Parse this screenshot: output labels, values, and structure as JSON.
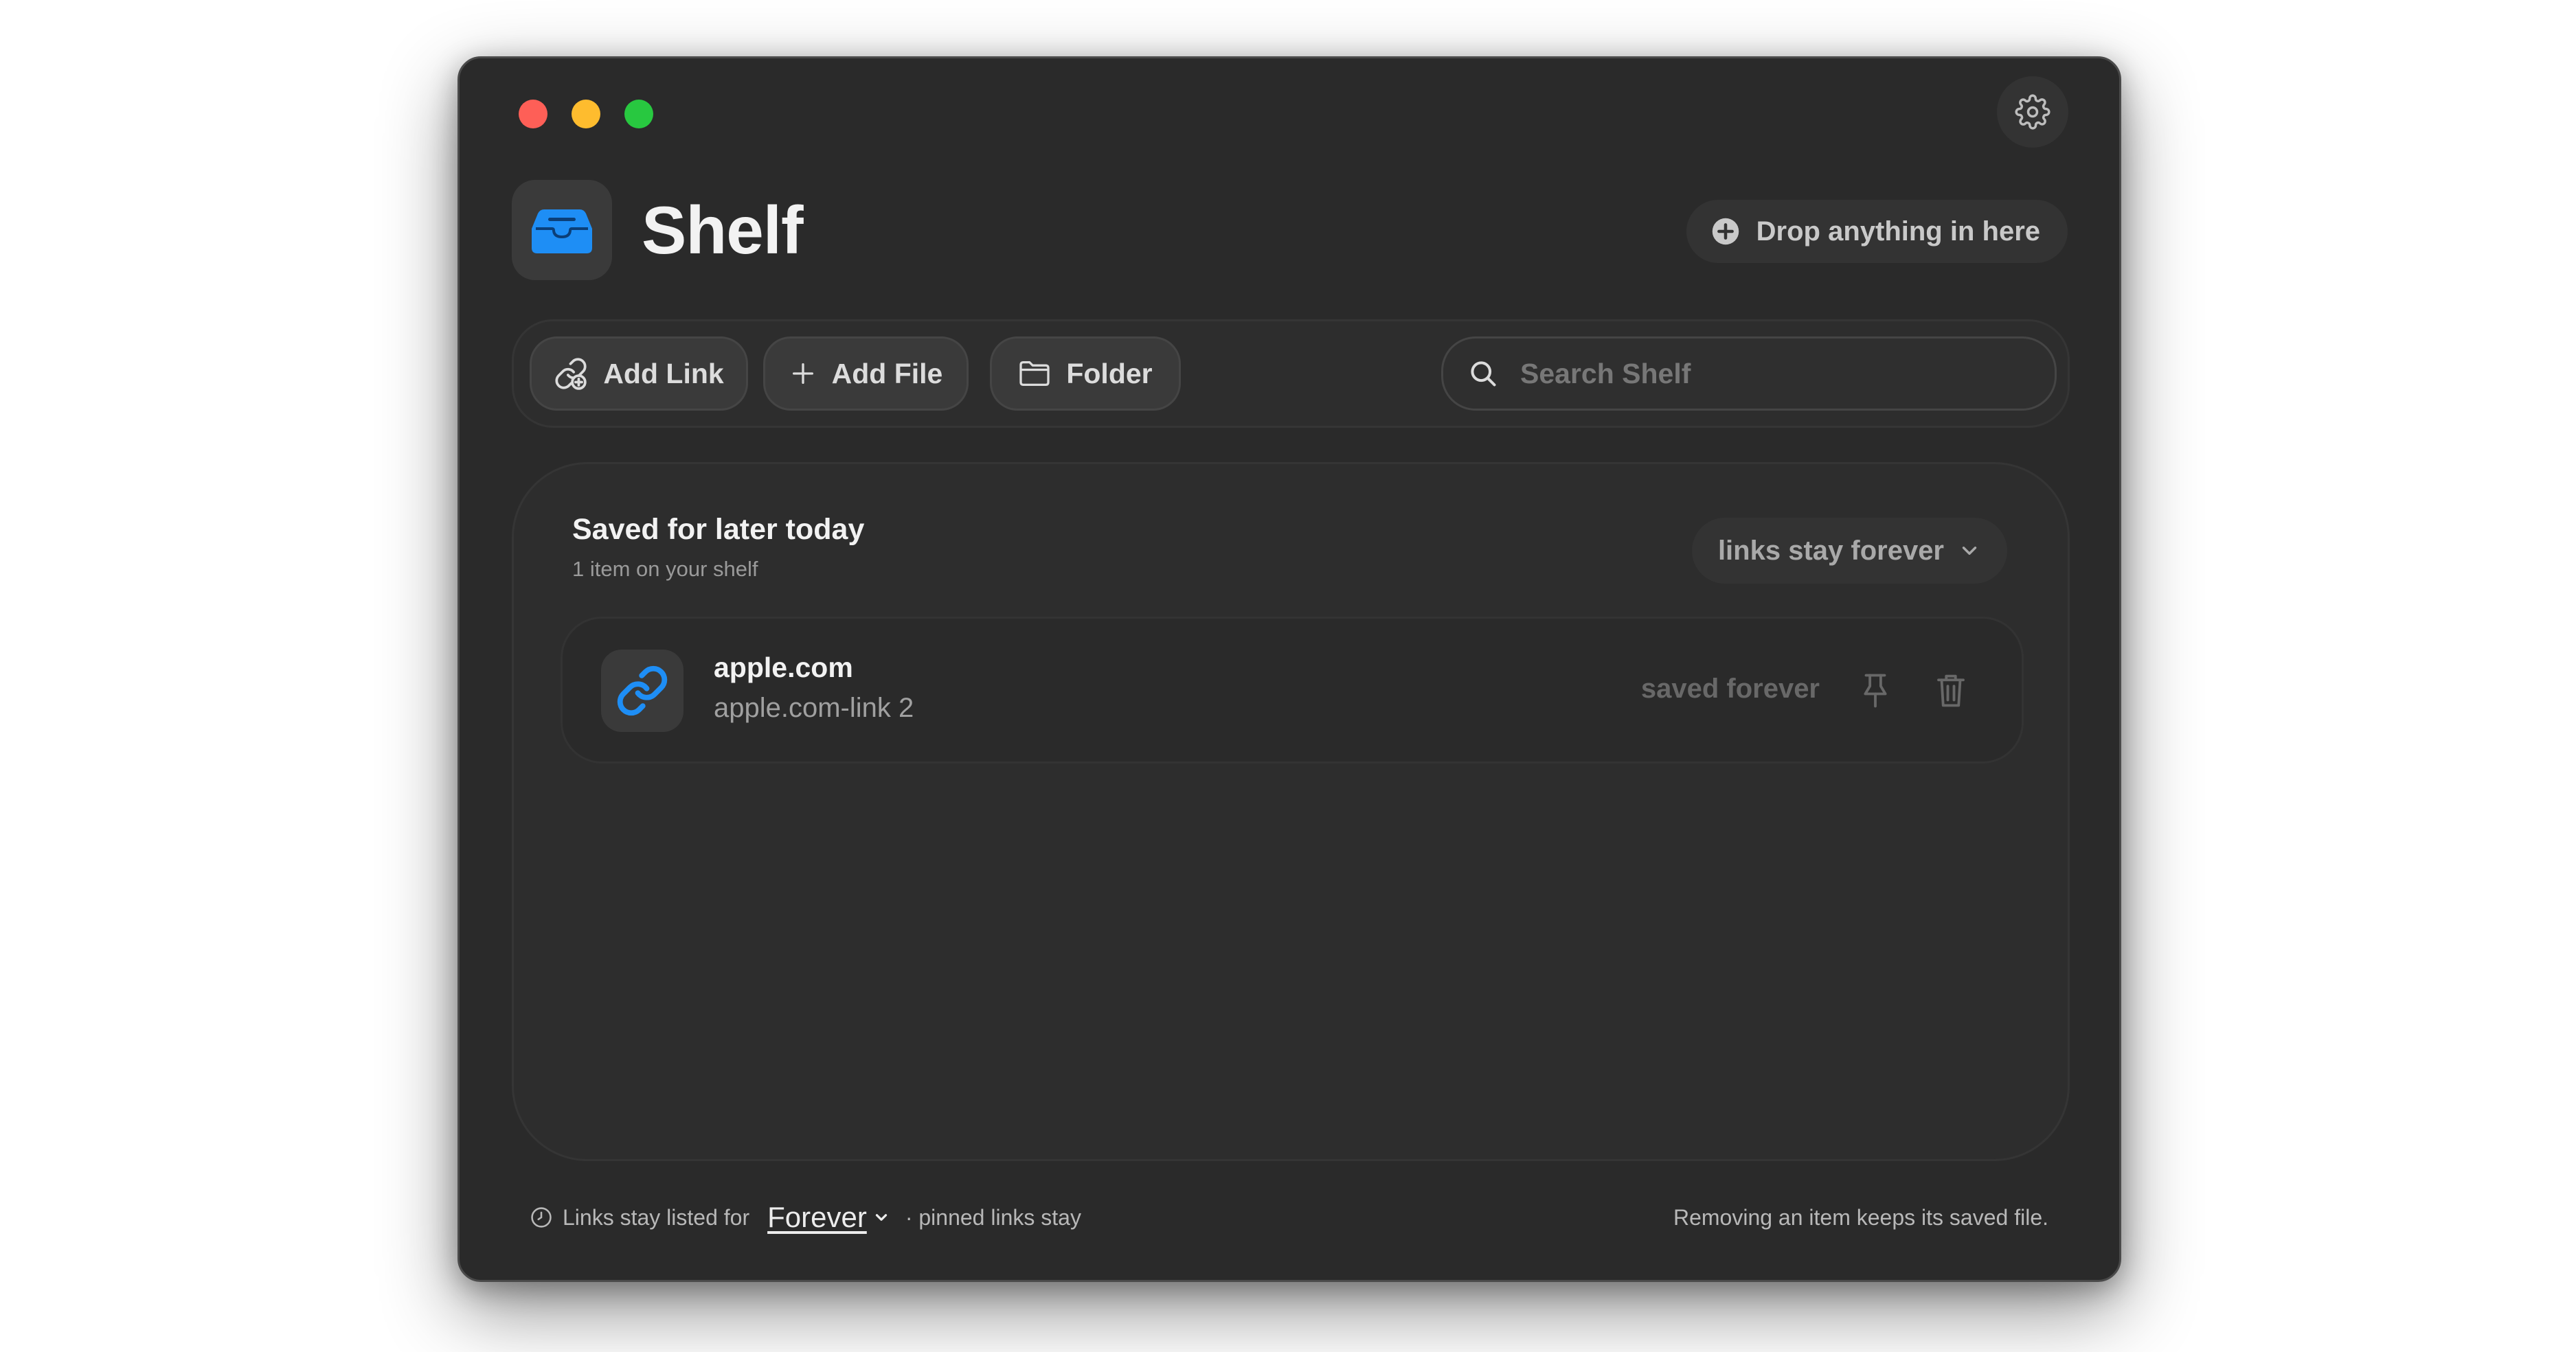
{
  "window": {
    "title": "Shelf",
    "drop_label": "Drop anything in here"
  },
  "toolbar": {
    "add_link_label": "Add Link",
    "add_file_label": "Add File",
    "folder_label": "Folder",
    "search_placeholder": "Search Shelf",
    "search_value": ""
  },
  "panel": {
    "title": "Saved for later today",
    "subtitle": "1 item on your shelf",
    "retention_dropdown": "links stay forever"
  },
  "items": [
    {
      "title": "apple.com",
      "subtitle": "apple.com-link 2",
      "status": "saved forever",
      "icon": "link-icon"
    }
  ],
  "footer": {
    "left_prefix": "Links stay listed for",
    "duration_value": "Forever",
    "left_suffix": "· pinned links stay",
    "right_text": "Removing an item keeps its saved file."
  },
  "colors": {
    "window_bg": "#2a2a2a",
    "accent_blue": "#1e8ef5",
    "traffic_red": "#fe5f57",
    "traffic_yellow": "#febc2e",
    "traffic_green": "#28c840"
  }
}
